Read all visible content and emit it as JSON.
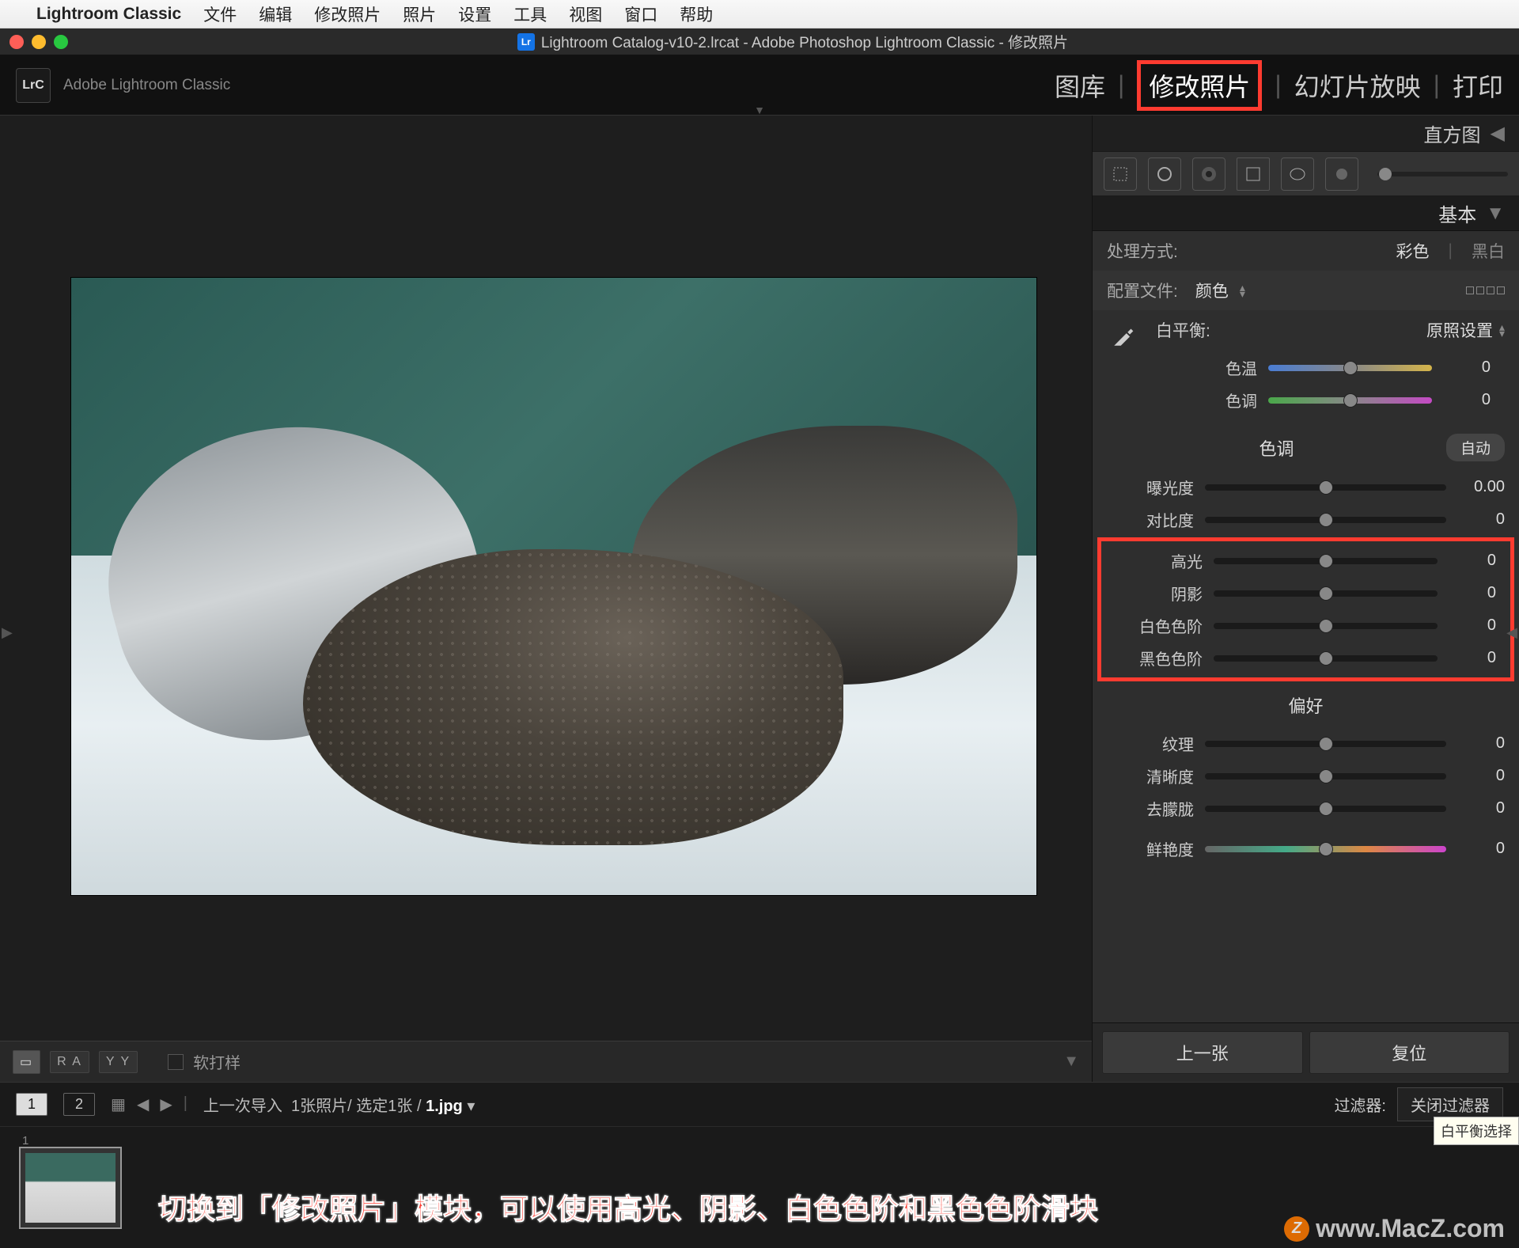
{
  "mac_menu": {
    "app": "Lightroom Classic",
    "items": [
      "文件",
      "编辑",
      "修改照片",
      "照片",
      "设置",
      "工具",
      "视图",
      "窗口",
      "帮助"
    ]
  },
  "window": {
    "title": "Lightroom Catalog-v10-2.lrcat - Adobe Photoshop Lightroom Classic - 修改照片"
  },
  "header": {
    "brand": "Adobe Lightroom Classic",
    "badge": "LrC",
    "modules": [
      "图库",
      "修改照片",
      "幻灯片放映",
      "打印"
    ],
    "active_module": "修改照片"
  },
  "right_panel": {
    "histogram": "直方图",
    "basic_title": "基本",
    "treatment": {
      "label": "处理方式:",
      "color": "彩色",
      "bw": "黑白"
    },
    "profile": {
      "label": "配置文件:",
      "value": "颜色"
    },
    "wb": {
      "label": "白平衡:",
      "preset": "原照设置",
      "temp_label": "色温",
      "temp_val": "0",
      "tint_label": "色调",
      "tint_val": "0"
    },
    "tone": {
      "title": "色调",
      "auto": "自动",
      "exposure_label": "曝光度",
      "exposure_val": "0.00",
      "contrast_label": "对比度",
      "contrast_val": "0",
      "highlights_label": "高光",
      "highlights_val": "0",
      "shadows_label": "阴影",
      "shadows_val": "0",
      "whites_label": "白色色阶",
      "whites_val": "0",
      "blacks_label": "黑色色阶",
      "blacks_val": "0"
    },
    "presence": {
      "title": "偏好",
      "texture_label": "纹理",
      "texture_val": "0",
      "clarity_label": "清晰度",
      "clarity_val": "0",
      "dehaze_label": "去朦胧",
      "dehaze_val": "0",
      "vibrance_label": "鲜艳度",
      "vibrance_val": "0"
    },
    "nav": {
      "prev": "上一张",
      "reset": "复位"
    }
  },
  "bottom_toolbar": {
    "btn1": "R A",
    "btn2": "Y Y",
    "soft_proof": "软打样"
  },
  "secondary": {
    "view1": "1",
    "view2": "2",
    "path_prefix": "上一次导入",
    "path_mid": "1张照片/ 选定1张 /",
    "path_file": "1.jpg",
    "filter_label": "过滤器:",
    "filter_value": "关闭过滤器"
  },
  "filmstrip": {
    "thumb_num": "1"
  },
  "tooltip": "白平衡选择",
  "annotation": "切换到「修改照片」模块，可以使用高光、阴影、白色色阶和黑色色阶滑块",
  "watermark": "www.MacZ.com"
}
